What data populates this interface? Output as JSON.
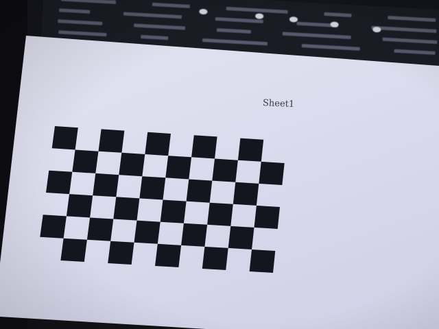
{
  "sheet_label": "Sheet1",
  "checkerboard": {
    "rows": 6,
    "cols": 10,
    "square_color": "#15151f",
    "paper_color": "#dedef0"
  },
  "colors": {
    "background": "#121217",
    "reflection": "#1b1b24"
  }
}
